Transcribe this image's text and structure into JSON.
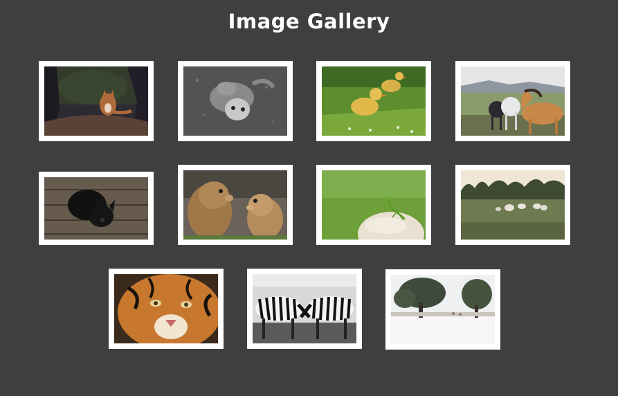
{
  "header": {
    "title": "Image Gallery"
  },
  "gallery": {
    "images": [
      {
        "subject": "fox-in-forest"
      },
      {
        "subject": "cat-on-back-grayscale"
      },
      {
        "subject": "ducklings-on-grass"
      },
      {
        "subject": "horses-in-field"
      },
      {
        "subject": "black-puppy-on-wood"
      },
      {
        "subject": "prairie-dogs"
      },
      {
        "subject": "praying-mantis-on-stone"
      },
      {
        "subject": "sheep-in-meadow"
      },
      {
        "subject": "tiger-closeup"
      },
      {
        "subject": "zebras-grayscale"
      },
      {
        "subject": "snowy-field-trees"
      }
    ]
  },
  "colors": {
    "background": "#3f3f3f",
    "frame": "#ffffff",
    "title": "#ffffff"
  }
}
